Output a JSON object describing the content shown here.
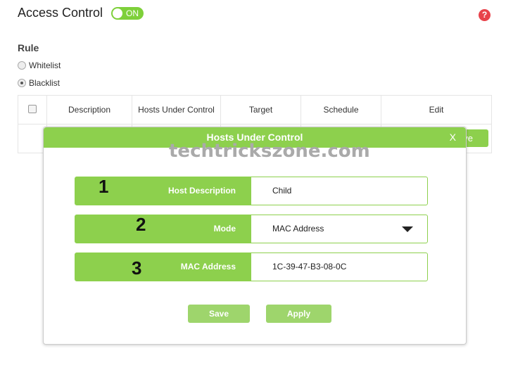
{
  "header": {
    "title": "Access Control",
    "toggle": "ON",
    "help": "?"
  },
  "rule": {
    "label": "Rule",
    "options": [
      {
        "label": "Whitelist",
        "checked": false
      },
      {
        "label": "Blacklist",
        "checked": true
      }
    ]
  },
  "table": {
    "columns": [
      "Description",
      "Hosts Under Control",
      "Target",
      "Schedule",
      "Edit"
    ],
    "row_button": "Remove"
  },
  "modal": {
    "title": "Hosts Under Control",
    "close": "X",
    "fields": [
      {
        "num": "1",
        "label": "Host Description",
        "value": "Child"
      },
      {
        "num": "2",
        "label": "Mode",
        "value": "MAC Address"
      },
      {
        "num": "3",
        "label": "MAC Address",
        "value": "1C-39-47-B3-08-0C"
      }
    ],
    "save": "Save",
    "apply": "Apply"
  },
  "watermark": "techtrickszone.com",
  "colors": {
    "accent": "#8dd04d",
    "help": "#e8424a"
  }
}
